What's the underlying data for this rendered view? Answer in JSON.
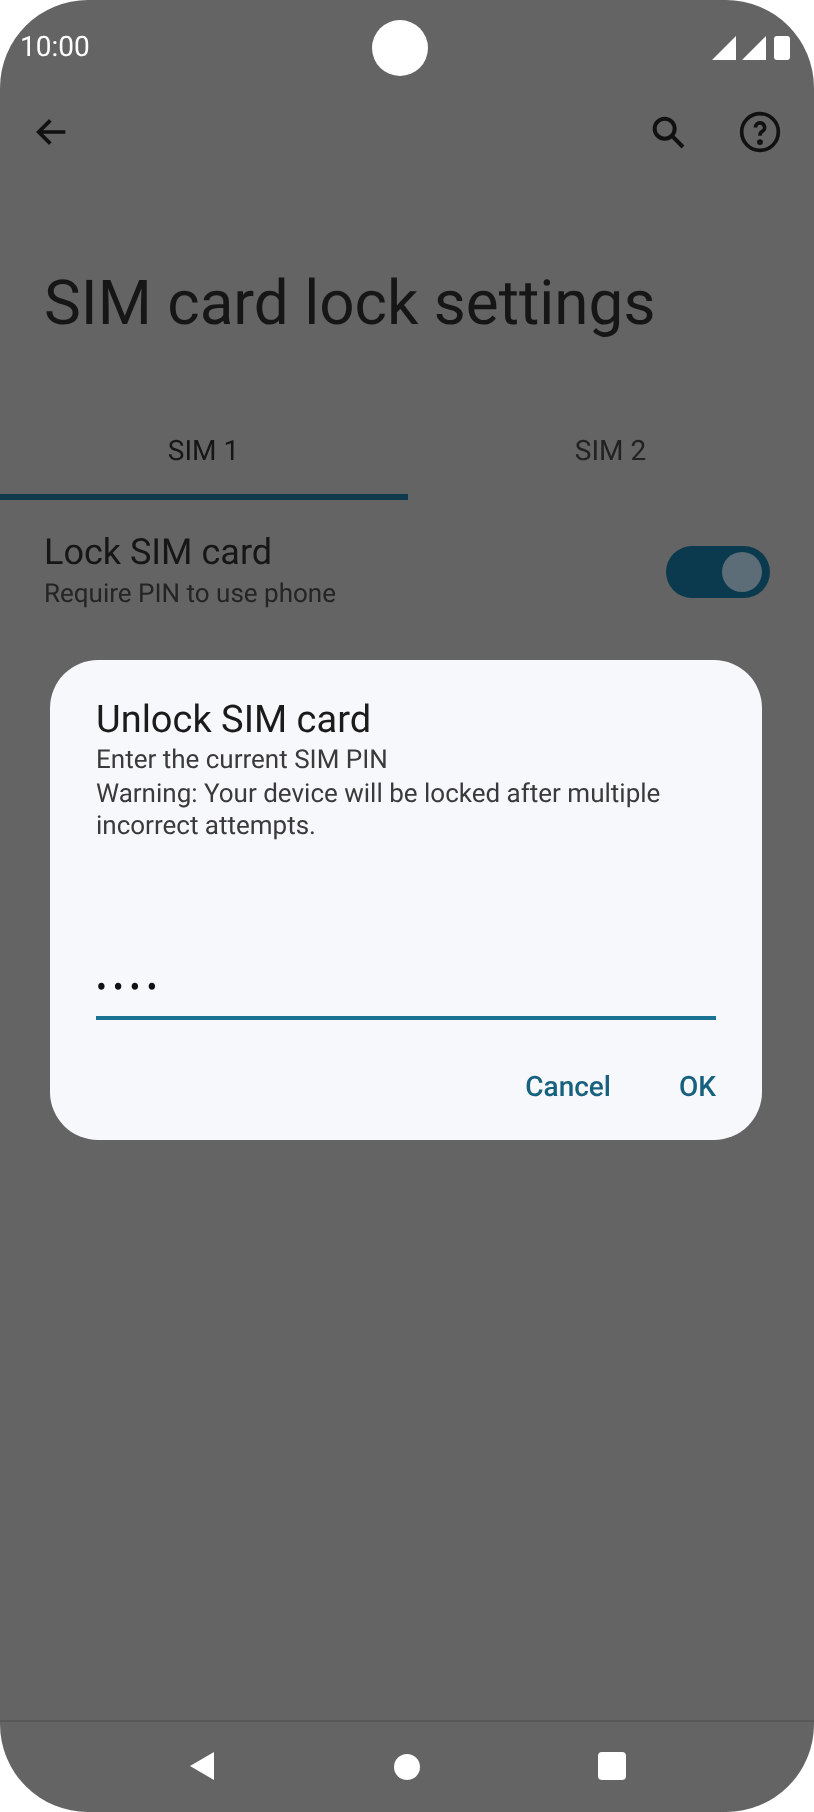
{
  "status_bar": {
    "time": "10:00"
  },
  "title": "SIM card lock settings",
  "tabs": [
    {
      "label": "SIM 1",
      "selected": true
    },
    {
      "label": "SIM 2",
      "selected": false
    }
  ],
  "settings": [
    {
      "title": "Lock SIM card",
      "subtitle": "Require PIN to use phone",
      "on": true
    }
  ],
  "dialog": {
    "title": "Unlock SIM card",
    "message": [
      "Enter the current SIM PIN",
      "Warning: Your device will be locked after multiple incorrect attempts."
    ],
    "value": "••••",
    "buttons": [
      "Cancel",
      "OK"
    ]
  }
}
